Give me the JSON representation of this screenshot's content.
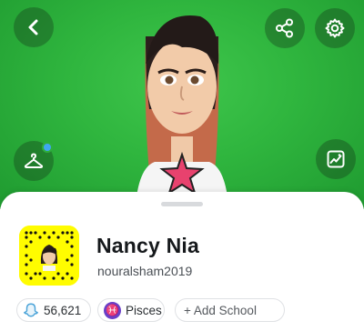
{
  "profile": {
    "display_name": "Nancy Nia",
    "username": "nouralsham2019"
  },
  "chips": {
    "snap_score": "56,621",
    "zodiac": "Pisces",
    "zodiac_symbol": "♓",
    "add_school": "+ Add School"
  },
  "icons": {
    "back": "chevron-left-icon",
    "share": "share-icon",
    "settings": "gear-icon",
    "outfit": "hanger-icon",
    "story": "photo-icon"
  },
  "colors": {
    "header_green": "#2fb53e",
    "snapcode_yellow": "#fffc00",
    "zodiac_purple": "#6a3fc7",
    "notification_blue": "#3fa7f0"
  }
}
